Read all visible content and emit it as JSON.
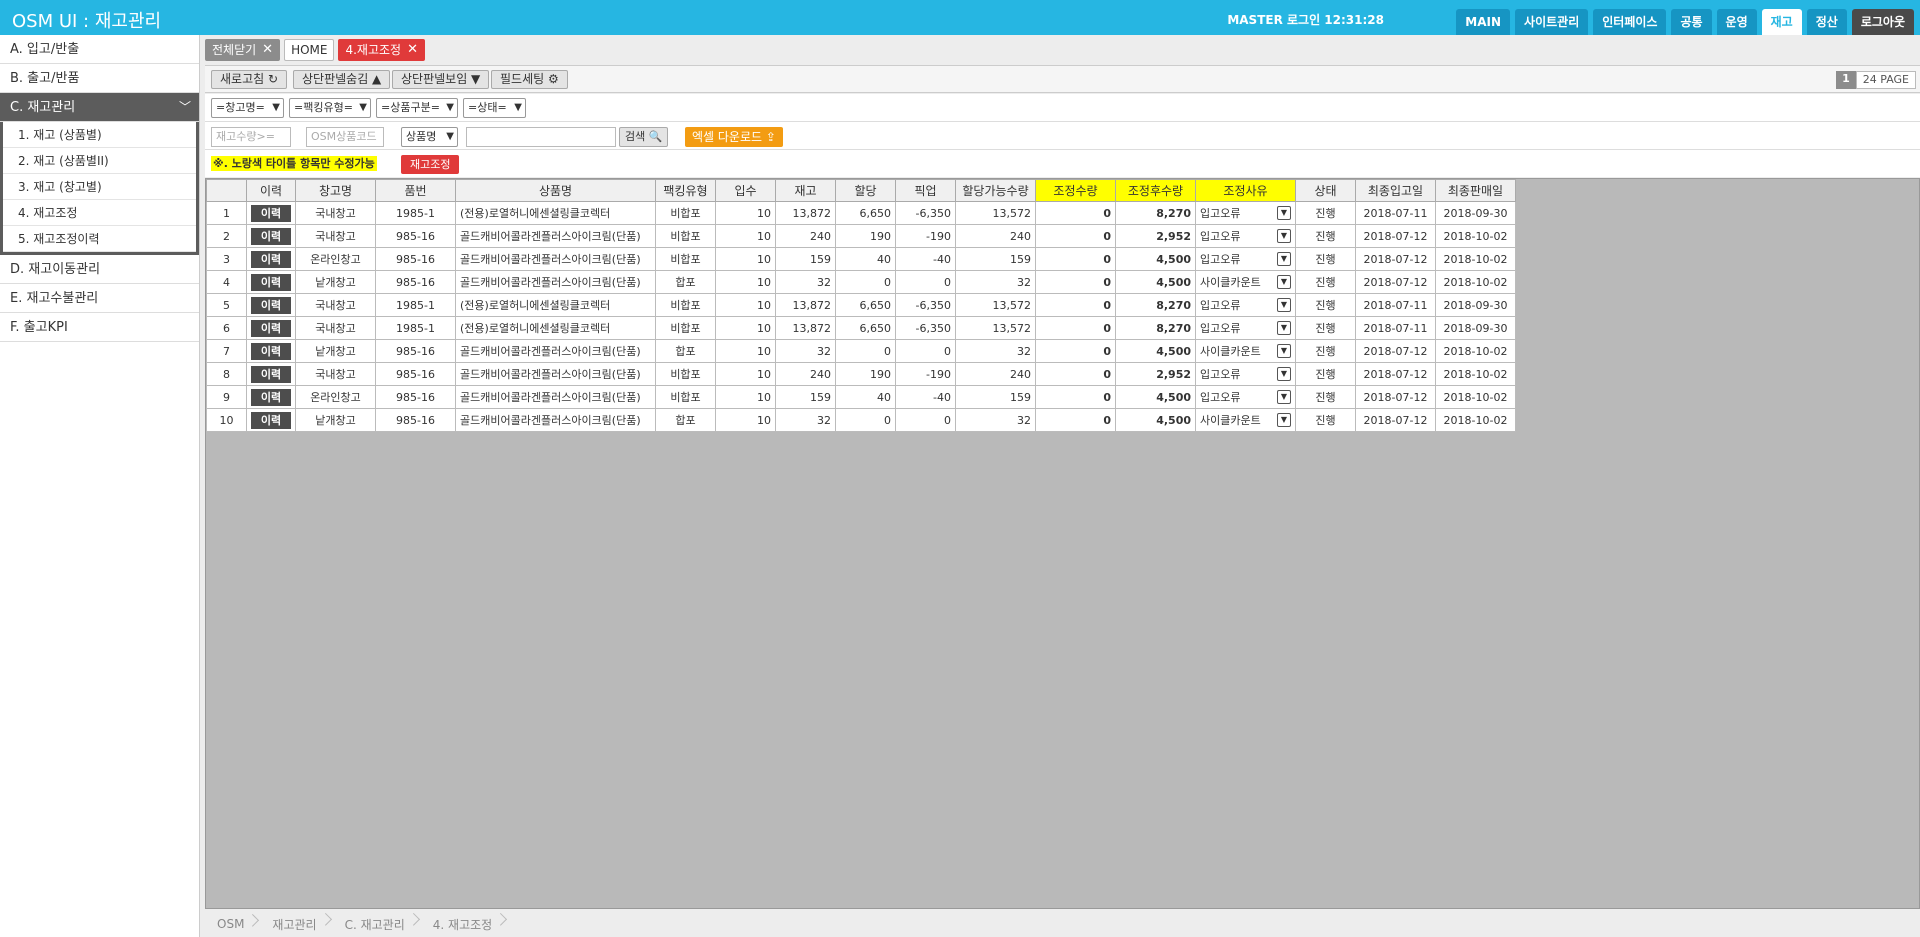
{
  "header": {
    "title": "OSM UI : 재고관리",
    "login_info": "MASTER 로그인 12:31:28",
    "nav": [
      "MAIN",
      "사이트관리",
      "인터페이스",
      "공통",
      "운영",
      "재고",
      "정산",
      "로그아웃"
    ],
    "active_nav": "재고"
  },
  "sidebar": {
    "items": [
      {
        "label": "A. 입고/반출"
      },
      {
        "label": "B. 출고/반품"
      },
      {
        "label": "C. 재고관리"
      },
      {
        "label": "D. 재고이동관리"
      },
      {
        "label": "E. 재고수불관리"
      },
      {
        "label": "F. 출고KPI"
      }
    ],
    "submenu": [
      "1. 재고 (상품별)",
      "2. 재고 (상품별II)",
      "3. 재고 (창고별)",
      "4. 재고조정",
      "5. 재고조정이력"
    ]
  },
  "tabs": {
    "close_all": "전체닫기",
    "home": "HOME",
    "current": "4.재고조정"
  },
  "toolbar": {
    "refresh": "새로고침 ↻",
    "hide_panel": "상단판넬숨김 ▲",
    "show_panel": "상단판넬보임 ▼",
    "field_setting": "필드세팅 ⚙",
    "page_current": "1",
    "page_total": "24 PAGE"
  },
  "filters": {
    "warehouse": "=창고명=",
    "packing": "=팩킹유형=",
    "product_type": "=상품구분=",
    "status": "=상태="
  },
  "search": {
    "stock_qty_placeholder": "재고수량>=",
    "osm_code_placeholder": "OSM상품코드",
    "field_select": "상품명",
    "search_button": "검색 🔍",
    "excel_button": "엑셀 다운로드 ⇪"
  },
  "notice": {
    "text": "※. 노랑색 타이틀 항목만 수정가능",
    "adjust_button": "재고조정"
  },
  "table": {
    "columns": [
      "",
      "이력",
      "창고명",
      "품번",
      "상품명",
      "팩킹유형",
      "입수",
      "재고",
      "할당",
      "픽업",
      "할당가능수량",
      "조정수량",
      "조정후수량",
      "조정사유",
      "상태",
      "최종입고일",
      "최종판매일"
    ],
    "highlight_columns": [
      "조정수량",
      "조정후수량",
      "조정사유"
    ],
    "history_label": "이력",
    "rows": [
      {
        "no": "1",
        "warehouse": "국내창고",
        "code": "1985-1",
        "name": "(전용)로열허니에센셜링클코렉터",
        "packing": "비합포",
        "unit": "10",
        "stock": "13,872",
        "alloc": "6,650",
        "pick": "-6,350",
        "avail": "13,572",
        "adj": "0",
        "after": "8,270",
        "reason": "입고오류",
        "status": "진행",
        "last_in": "2018-07-11",
        "last_sale": "2018-09-30"
      },
      {
        "no": "2",
        "warehouse": "국내창고",
        "code": "985-16",
        "name": "골드캐비어콜라겐플러스아이크림(단품)",
        "packing": "비합포",
        "unit": "10",
        "stock": "240",
        "alloc": "190",
        "pick": "-190",
        "avail": "240",
        "adj": "0",
        "after": "2,952",
        "reason": "입고오류",
        "status": "진행",
        "last_in": "2018-07-12",
        "last_sale": "2018-10-02"
      },
      {
        "no": "3",
        "warehouse": "온라인창고",
        "code": "985-16",
        "name": "골드캐비어콜라겐플러스아이크림(단품)",
        "packing": "비합포",
        "unit": "10",
        "stock": "159",
        "alloc": "40",
        "pick": "-40",
        "avail": "159",
        "adj": "0",
        "after": "4,500",
        "reason": "입고오류",
        "status": "진행",
        "last_in": "2018-07-12",
        "last_sale": "2018-10-02"
      },
      {
        "no": "4",
        "warehouse": "낱개창고",
        "code": "985-16",
        "name": "골드캐비어콜라겐플러스아이크림(단품)",
        "packing": "합포",
        "unit": "10",
        "stock": "32",
        "alloc": "0",
        "pick": "0",
        "avail": "32",
        "adj": "0",
        "after": "4,500",
        "reason": "사이클카운트",
        "status": "진행",
        "last_in": "2018-07-12",
        "last_sale": "2018-10-02"
      },
      {
        "no": "5",
        "warehouse": "국내창고",
        "code": "1985-1",
        "name": "(전용)로열허니에센셜링클코렉터",
        "packing": "비합포",
        "unit": "10",
        "stock": "13,872",
        "alloc": "6,650",
        "pick": "-6,350",
        "avail": "13,572",
        "adj": "0",
        "after": "8,270",
        "reason": "입고오류",
        "status": "진행",
        "last_in": "2018-07-11",
        "last_sale": "2018-09-30"
      },
      {
        "no": "6",
        "warehouse": "국내창고",
        "code": "1985-1",
        "name": "(전용)로열허니에센셜링클코렉터",
        "packing": "비합포",
        "unit": "10",
        "stock": "13,872",
        "alloc": "6,650",
        "pick": "-6,350",
        "avail": "13,572",
        "adj": "0",
        "after": "8,270",
        "reason": "입고오류",
        "status": "진행",
        "last_in": "2018-07-11",
        "last_sale": "2018-09-30"
      },
      {
        "no": "7",
        "warehouse": "낱개창고",
        "code": "985-16",
        "name": "골드캐비어콜라겐플러스아이크림(단품)",
        "packing": "합포",
        "unit": "10",
        "stock": "32",
        "alloc": "0",
        "pick": "0",
        "avail": "32",
        "adj": "0",
        "after": "4,500",
        "reason": "사이클카운트",
        "status": "진행",
        "last_in": "2018-07-12",
        "last_sale": "2018-10-02"
      },
      {
        "no": "8",
        "warehouse": "국내창고",
        "code": "985-16",
        "name": "골드캐비어콜라겐플러스아이크림(단품)",
        "packing": "비합포",
        "unit": "10",
        "stock": "240",
        "alloc": "190",
        "pick": "-190",
        "avail": "240",
        "adj": "0",
        "after": "2,952",
        "reason": "입고오류",
        "status": "진행",
        "last_in": "2018-07-12",
        "last_sale": "2018-10-02"
      },
      {
        "no": "9",
        "warehouse": "온라인창고",
        "code": "985-16",
        "name": "골드캐비어콜라겐플러스아이크림(단품)",
        "packing": "비합포",
        "unit": "10",
        "stock": "159",
        "alloc": "40",
        "pick": "-40",
        "avail": "159",
        "adj": "0",
        "after": "4,500",
        "reason": "입고오류",
        "status": "진행",
        "last_in": "2018-07-12",
        "last_sale": "2018-10-02"
      },
      {
        "no": "10",
        "warehouse": "낱개창고",
        "code": "985-16",
        "name": "골드캐비어콜라겐플러스아이크림(단품)",
        "packing": "합포",
        "unit": "10",
        "stock": "32",
        "alloc": "0",
        "pick": "0",
        "avail": "32",
        "adj": "0",
        "after": "4,500",
        "reason": "사이클카운트",
        "status": "진행",
        "last_in": "2018-07-12",
        "last_sale": "2018-10-02"
      }
    ]
  },
  "breadcrumb": [
    "OSM",
    "재고관리",
    "C. 재고관리",
    "4. 재고조정"
  ],
  "colors": {
    "header_bg": "#26b6e2",
    "highlight": "#ffff00",
    "danger": "#e03a3a",
    "excel": "#f39c12"
  }
}
